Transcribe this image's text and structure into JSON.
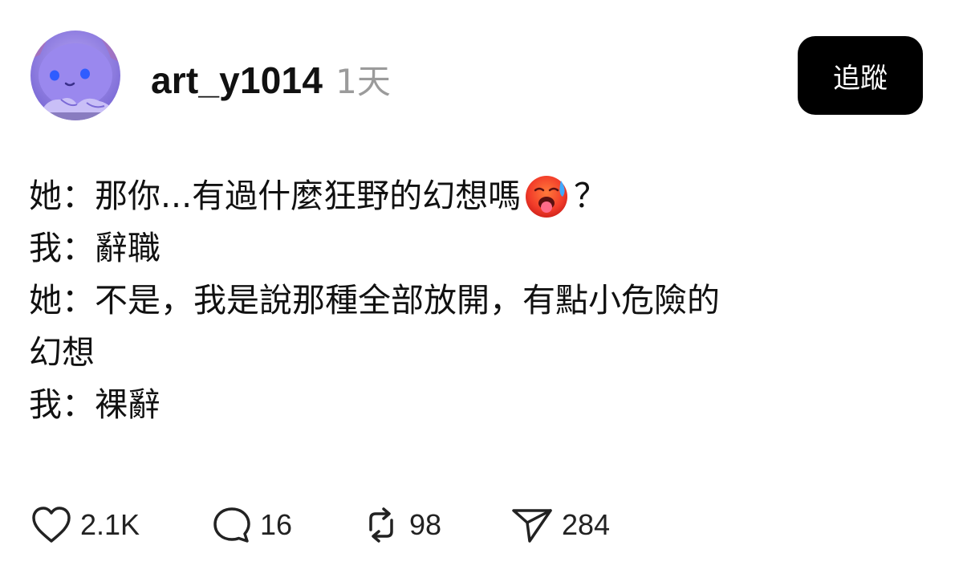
{
  "post": {
    "author": {
      "username": "art_y1014",
      "avatar_icon": "avatar-purple-character"
    },
    "timestamp": "1天",
    "follow_label": "追蹤",
    "lines": [
      {
        "text": "她：那你...有過什麼狂野的幻想嗎",
        "emoji": "hot-face-emoji",
        "suffix": "？"
      },
      {
        "text": "我：辭職"
      },
      {
        "text": "她：不是，我是說那種全部放開，有點小危險的"
      },
      {
        "text": "幻想"
      },
      {
        "text": "我：裸辭"
      }
    ]
  },
  "actions": {
    "like": {
      "icon": "heart-icon",
      "count": "2.1K"
    },
    "comment": {
      "icon": "comment-bubble-icon",
      "count": "16"
    },
    "repost": {
      "icon": "repost-icon",
      "count": "98"
    },
    "share": {
      "icon": "send-icon",
      "count": "284"
    }
  },
  "colors": {
    "text": "#111111",
    "muted": "#9b9b9b",
    "follow_bg": "#000000",
    "follow_text": "#ffffff",
    "avatar": "#8a7cf0"
  }
}
